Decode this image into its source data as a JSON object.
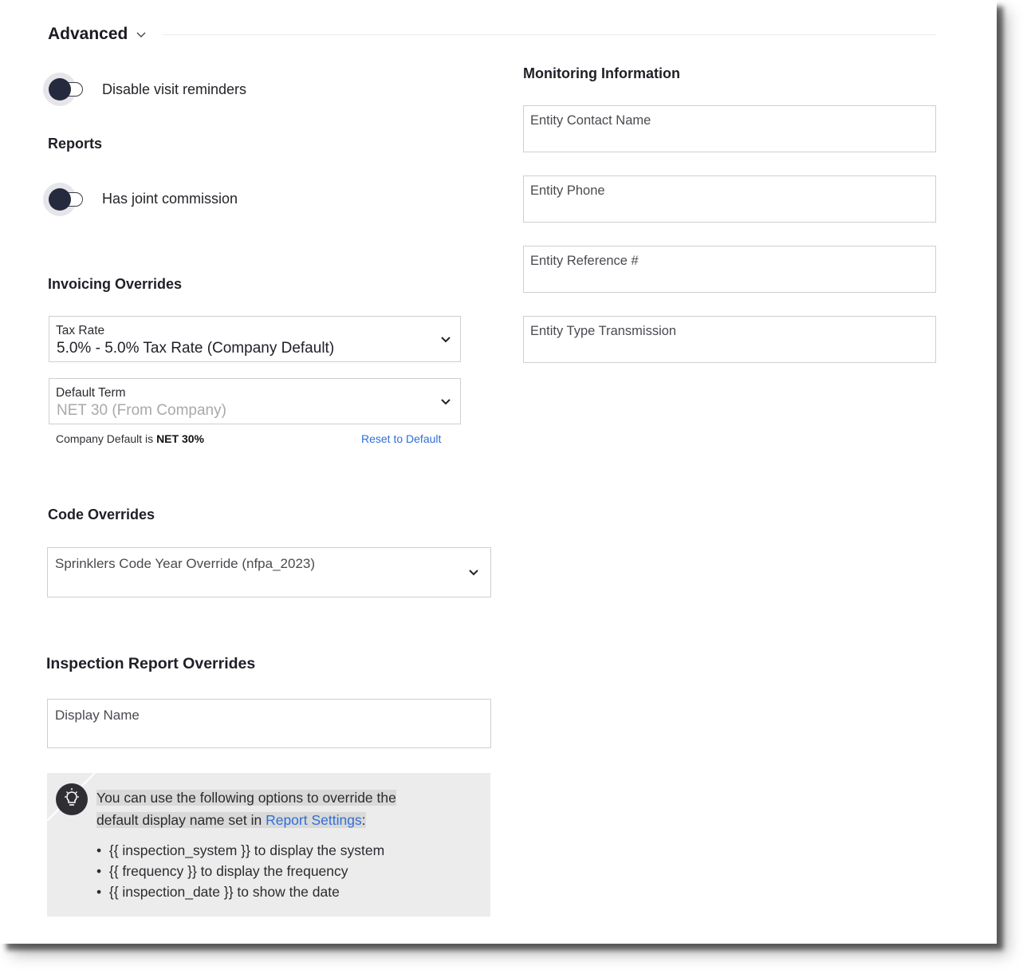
{
  "advanced": {
    "title": "Advanced"
  },
  "toggles": {
    "disable_visit_reminders": "Disable visit reminders",
    "has_joint_commission": "Has joint commission"
  },
  "reports": {
    "title": "Reports"
  },
  "invoicing": {
    "title": "Invoicing Overrides",
    "tax_rate_label": "Tax Rate",
    "tax_rate_value": "5.0% - 5.0% Tax Rate (Company Default)",
    "default_term_label": "Default Term",
    "default_term_placeholder": "NET 30 (From Company)",
    "company_default_prefix": "Company Default is ",
    "company_default_value": "NET 30%",
    "reset_label": "Reset to Default"
  },
  "code_overrides": {
    "title": "Code Overrides",
    "sprinklers_placeholder": "Sprinklers Code Year Override (nfpa_2023)"
  },
  "inspection_report": {
    "title": "Inspection Report Overrides",
    "display_name_label": "Display Name",
    "info_line1": "You can use the following options to override the",
    "info_line2_prefix": "default display name set in ",
    "info_link": "Report Settings",
    "info_line2_suffix": ":",
    "bullets": [
      "{{ inspection_system }} to display the system",
      "{{ frequency }} to display the frequency",
      "{{ inspection_date }} to show the date"
    ]
  },
  "monitoring": {
    "title": "Monitoring Information",
    "fields": [
      "Entity Contact Name",
      "Entity Phone",
      "Entity Reference #",
      "Entity Type Transmission"
    ]
  },
  "icons": {
    "chevron": "chevron-down-icon",
    "bulb": "lightbulb-icon",
    "accent_link": "#2f6fd6",
    "toggle_knob": "#262a3e"
  }
}
